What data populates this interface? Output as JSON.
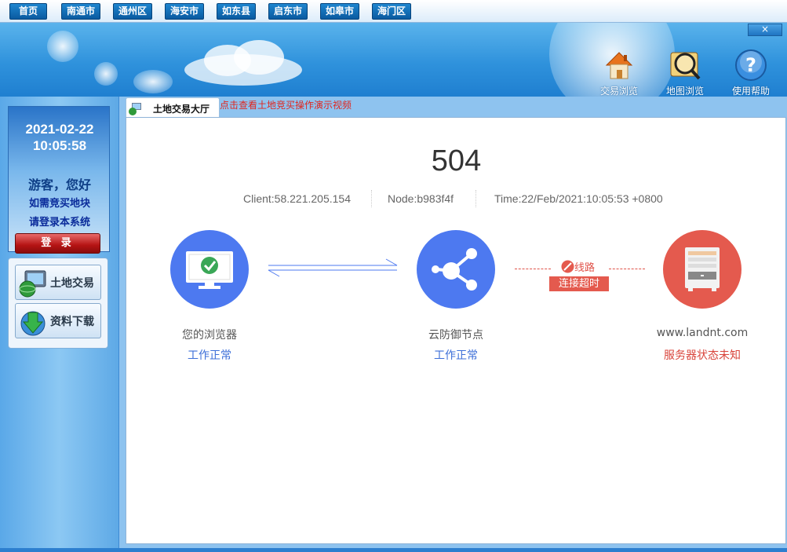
{
  "topnav": {
    "items": [
      "首页",
      "南通市",
      "通州区",
      "海安市",
      "如东县",
      "启东市",
      "如皋市",
      "海门区"
    ]
  },
  "banner": {
    "close_label": "×",
    "tools": [
      {
        "label": "交易浏览",
        "icon": "house-icon"
      },
      {
        "label": "地图浏览",
        "icon": "map-magnifier-icon"
      },
      {
        "label": "使用帮助",
        "icon": "help-icon"
      }
    ]
  },
  "sidebar": {
    "date": "2021-02-22",
    "time": "10:05:58",
    "greeting": "游客，您好",
    "hint1": "如需竞买地块",
    "hint2": "请登录本系统",
    "login_label": "登 录",
    "menu": [
      {
        "label": "土地交易",
        "icon": "globe-computer-icon"
      },
      {
        "label": "资料下载",
        "icon": "download-globe-icon"
      }
    ]
  },
  "tab": {
    "label": "土地交易大厅",
    "video_link": "点击查看土地竞买操作演示视频"
  },
  "error": {
    "code": "504",
    "client": "Client:58.221.205.154",
    "node": "Node:b983f4f",
    "time": "Time:22/Feb/2021:10:05:53 +0800",
    "browser_name": "您的浏览器",
    "browser_status": "工作正常",
    "cdn_name": "云防御节点",
    "cdn_status": "工作正常",
    "link_label": "线路",
    "link_status": "连接超时",
    "server_name": "www.landnt.com",
    "server_status": "服务器状态未知"
  },
  "colors": {
    "blue": "#4d79f0",
    "red": "#e45a4e",
    "status_blue": "#3d6fd8",
    "status_red": "#d9453c"
  }
}
